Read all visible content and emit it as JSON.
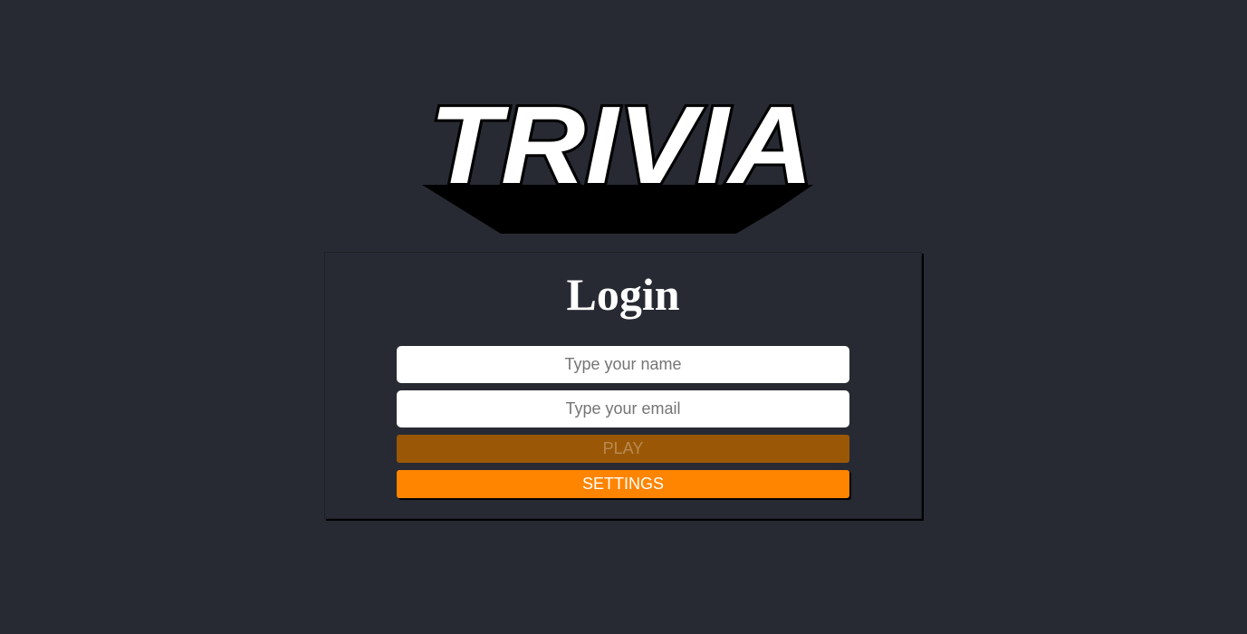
{
  "logo": {
    "text": "TRIVIA"
  },
  "login": {
    "title": "Login",
    "name_placeholder": "Type your name",
    "email_placeholder": "Type your email",
    "play_label": "PLAY",
    "settings_label": "SETTINGS"
  },
  "colors": {
    "background": "#282a33",
    "accent": "#ff8400",
    "accent_disabled": "#9a5807",
    "title_text": "#ffffff"
  }
}
